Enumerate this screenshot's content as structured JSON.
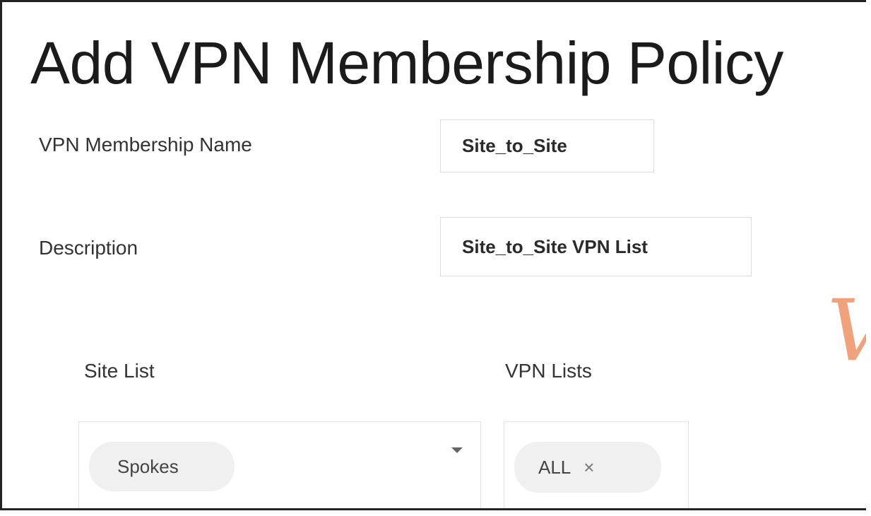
{
  "dialog": {
    "title": "Add VPN Membership Policy"
  },
  "form": {
    "name_label": "VPN Membership Name",
    "name_value": "Site_to_Site",
    "description_label": "Description",
    "description_value": "Site_to_Site VPN List",
    "site_list_label": "Site List",
    "site_list_selected": "Spokes",
    "vpn_lists_label": "VPN Lists",
    "vpn_lists_selected": "ALL",
    "remove_symbol": "×"
  },
  "watermark": {
    "text": "V",
    "color": "#f0a27c"
  },
  "icons": {
    "dropdown": "chevron-down-icon",
    "remove": "close-icon"
  }
}
